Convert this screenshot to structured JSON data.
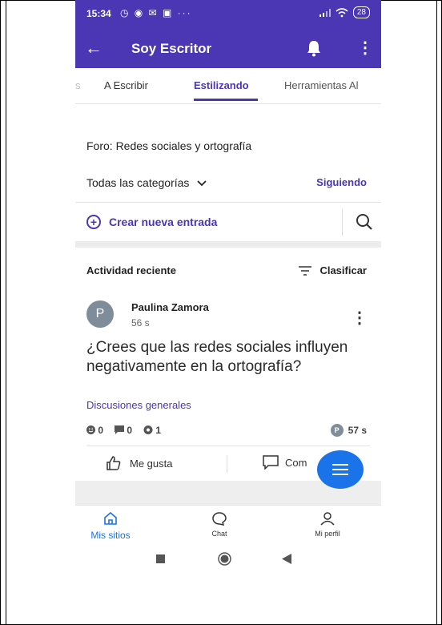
{
  "status_bar": {
    "time": "15:34",
    "notification_icons": "◷ ◉ ✉ ▣ ···",
    "battery": "28"
  },
  "app_bar": {
    "title": "Soy Escritor"
  },
  "tabs": [
    {
      "label": "s"
    },
    {
      "label": "A Escribir"
    },
    {
      "label": "Estilizando"
    },
    {
      "label": "Herramientas Al"
    }
  ],
  "forum": {
    "title": "Foro: Redes sociales y ortografía",
    "categories_label": "Todas las categorías",
    "following_label": "Siguiendo",
    "new_post_label": "Crear nueva entrada",
    "activity_label": "Actividad reciente",
    "sort_label": "Clasificar"
  },
  "post": {
    "avatar_letter": "P",
    "author": "Paulina Zamora",
    "time_ago": "56 s",
    "title": "¿Crees que las redes sociales influyen negativamente en la ortografía?",
    "category": "Discusiones generales",
    "reactions": "0",
    "comments": "0",
    "views": "1",
    "last_activity": "57 s",
    "like_label": "Me gusta",
    "comment_label": "Com"
  },
  "bottom_nav": [
    {
      "label": "Mis sitios"
    },
    {
      "label": "Chat"
    },
    {
      "label": "Mi perfil"
    }
  ],
  "colors": {
    "primary": "#4b36b3",
    "accent": "#1a73e8"
  }
}
